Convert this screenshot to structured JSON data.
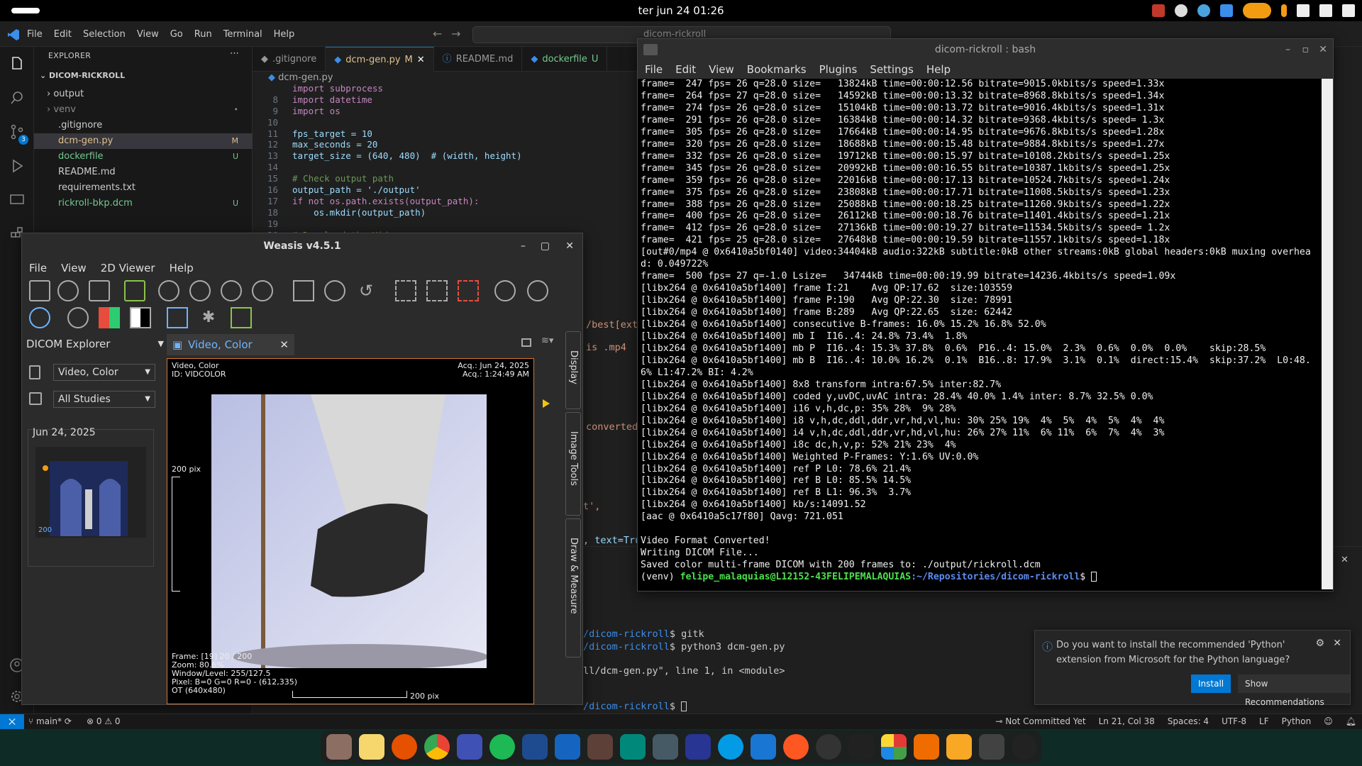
{
  "topbar": {
    "clock": "ter jun 24  01:26"
  },
  "vscode": {
    "menu": [
      "File",
      "Edit",
      "Selection",
      "View",
      "Go",
      "Run",
      "Terminal",
      "Help"
    ],
    "search": "dicom-rickroll",
    "explorer_title": "EXPLORER",
    "folder": "DICOM-RICKROLL",
    "tree": [
      {
        "label": "output",
        "type": "folder",
        "badge": ""
      },
      {
        "label": "venv",
        "type": "folder",
        "badge": "•"
      },
      {
        "label": ".gitignore",
        "type": "file",
        "badge": ""
      },
      {
        "label": "dcm-gen.py",
        "type": "file",
        "badge": "M"
      },
      {
        "label": "dockerfile",
        "type": "file",
        "badge": "U"
      },
      {
        "label": "README.md",
        "type": "file",
        "badge": ""
      },
      {
        "label": "requirements.txt",
        "type": "file",
        "badge": ""
      },
      {
        "label": "rickroll-bkp.dcm",
        "type": "file",
        "badge": "U"
      }
    ],
    "tabs": [
      {
        "label": ".gitignore",
        "badge": ""
      },
      {
        "label": "dcm-gen.py",
        "badge": "M"
      },
      {
        "label": "README.md",
        "badge": ""
      },
      {
        "label": "dockerfile",
        "badge": "U"
      }
    ],
    "breadcrumb": "dcm-gen.py",
    "code_lines": [
      {
        "n": "",
        "t": "import subprocess"
      },
      {
        "n": "8",
        "t": "import datetime"
      },
      {
        "n": "9",
        "t": "import os"
      },
      {
        "n": "10",
        "t": ""
      },
      {
        "n": "11",
        "t": "fps_target = 10"
      },
      {
        "n": "12",
        "t": "max_seconds = 20"
      },
      {
        "n": "13",
        "t": "target_size = (640, 480)  # (width, height)"
      },
      {
        "n": "14",
        "t": ""
      },
      {
        "n": "15",
        "t": "# Check output path"
      },
      {
        "n": "16",
        "t": "output_path = './output'"
      },
      {
        "n": "17",
        "t": "if not os.path.exists(output_path):"
      },
      {
        "n": "18",
        "t": "    os.mkdir(output_path)"
      },
      {
        "n": "19",
        "t": ""
      },
      {
        "n": "20",
        "t": "# Download the Video"
      }
    ],
    "behind_fragments": {
      "best": "/best[ext=",
      "mp4": "is .mp4",
      "converted": "converted.",
      "t": "t',",
      "text": ", text=Tru"
    },
    "behind_terminal": [
      {
        "p": "/dicom-rickroll",
        "t": "$ gitk"
      },
      {
        "p": "/dicom-rickroll",
        "t": "$ python3 dcm-gen.py"
      },
      {
        "p": "",
        "t": "ll/dcm-gen.py\", line 1, in <module>"
      },
      {
        "p": "",
        "t": ""
      },
      {
        "p": "/dicom-rickroll",
        "t": "$ "
      }
    ],
    "status": {
      "branch": "main*",
      "problems": "0",
      "warnings": "0",
      "right": [
        "Not Committed Yet",
        "Ln 21, Col 38",
        "Spaces: 4",
        "UTF-8",
        "LF",
        "Python"
      ]
    },
    "notification": {
      "text": "Do you want to install the recommended 'Python' extension from Microsoft for the Python language?",
      "install": "Install",
      "show": "Show Recommendations"
    }
  },
  "terminal": {
    "title": "dicom-rickroll : bash",
    "menu": [
      "File",
      "Edit",
      "View",
      "Bookmarks",
      "Plugins",
      "Settings",
      "Help"
    ],
    "lines": [
      "frame=  247 fps= 26 q=28.0 size=   13824kB time=00:00:12.56 bitrate=9015.0kbits/s speed=1.33x",
      "frame=  264 fps= 27 q=28.0 size=   14592kB time=00:00:13.32 bitrate=8968.8kbits/s speed=1.34x",
      "frame=  274 fps= 26 q=28.0 size=   15104kB time=00:00:13.72 bitrate=9016.4kbits/s speed=1.31x",
      "frame=  291 fps= 26 q=28.0 size=   16384kB time=00:00:14.32 bitrate=9368.4kbits/s speed= 1.3x",
      "frame=  305 fps= 26 q=28.0 size=   17664kB time=00:00:14.95 bitrate=9676.8kbits/s speed=1.28x",
      "frame=  320 fps= 26 q=28.0 size=   18688kB time=00:00:15.48 bitrate=9884.8kbits/s speed=1.27x",
      "frame=  332 fps= 26 q=28.0 size=   19712kB time=00:00:15.97 bitrate=10108.2kbits/s speed=1.25x",
      "frame=  345 fps= 26 q=28.0 size=   20992kB time=00:00:16.55 bitrate=10387.1kbits/s speed=1.25x",
      "frame=  359 fps= 26 q=28.0 size=   22016kB time=00:00:17.13 bitrate=10524.7kbits/s speed=1.24x",
      "frame=  375 fps= 26 q=28.0 size=   23808kB time=00:00:17.71 bitrate=11008.5kbits/s speed=1.23x",
      "frame=  388 fps= 26 q=28.0 size=   25088kB time=00:00:18.25 bitrate=11260.9kbits/s speed=1.22x",
      "frame=  400 fps= 26 q=28.0 size=   26112kB time=00:00:18.76 bitrate=11401.4kbits/s speed=1.21x",
      "frame=  412 fps= 26 q=28.0 size=   27136kB time=00:00:19.27 bitrate=11534.5kbits/s speed= 1.2x",
      "frame=  421 fps= 25 q=28.0 size=   27648kB time=00:00:19.59 bitrate=11557.1kbits/s speed=1.18x",
      "[out#0/mp4 @ 0x6410a5bf0140] video:34404kB audio:322kB subtitle:0kB other streams:0kB global headers:0kB muxing overhea",
      "d: 0.049722%",
      "frame=  500 fps= 27 q=-1.0 Lsize=   34744kB time=00:00:19.99 bitrate=14236.4kbits/s speed=1.09x",
      "[libx264 @ 0x6410a5bf1400] frame I:21    Avg QP:17.62  size:103559",
      "[libx264 @ 0x6410a5bf1400] frame P:190   Avg QP:22.30  size: 78991",
      "[libx264 @ 0x6410a5bf1400] frame B:289   Avg QP:22.65  size: 62442",
      "[libx264 @ 0x6410a5bf1400] consecutive B-frames: 16.0% 15.2% 16.8% 52.0%",
      "[libx264 @ 0x6410a5bf1400] mb I  I16..4: 24.8% 73.4%  1.8%",
      "[libx264 @ 0x6410a5bf1400] mb P  I16..4: 15.3% 37.8%  0.6%  P16..4: 15.0%  2.3%  0.6%  0.0%  0.0%    skip:28.5%",
      "[libx264 @ 0x6410a5bf1400] mb B  I16..4: 10.0% 16.2%  0.1%  B16..8: 17.9%  3.1%  0.1%  direct:15.4%  skip:37.2%  L0:48.",
      "6% L1:47.2% BI: 4.2%",
      "[libx264 @ 0x6410a5bf1400] 8x8 transform intra:67.5% inter:82.7%",
      "[libx264 @ 0x6410a5bf1400] coded y,uvDC,uvAC intra: 28.4% 40.0% 1.4% inter: 8.7% 32.5% 0.0%",
      "[libx264 @ 0x6410a5bf1400] i16 v,h,dc,p: 35% 28%  9% 28%",
      "[libx264 @ 0x6410a5bf1400] i8 v,h,dc,ddl,ddr,vr,hd,vl,hu: 30% 25% 19%  4%  5%  4%  5%  4%  4%",
      "[libx264 @ 0x6410a5bf1400] i4 v,h,dc,ddl,ddr,vr,hd,vl,hu: 26% 27% 11%  6% 11%  6%  7%  4%  3%",
      "[libx264 @ 0x6410a5bf1400] i8c dc,h,v,p: 52% 21% 23%  4%",
      "[libx264 @ 0x6410a5bf1400] Weighted P-Frames: Y:1.6% UV:0.0%",
      "[libx264 @ 0x6410a5bf1400] ref P L0: 78.6% 21.4%",
      "[libx264 @ 0x6410a5bf1400] ref B L0: 85.5% 14.5%",
      "[libx264 @ 0x6410a5bf1400] ref B L1: 96.3%  3.7%",
      "[libx264 @ 0x6410a5bf1400] kb/s:14091.52",
      "[aac @ 0x6410a5c17f80] Qavg: 721.051",
      "",
      "Video Format Converted!",
      "Writing DICOM File...",
      "Saved color multi-frame DICOM with 200 frames to: ./output/rickroll.dcm"
    ],
    "prompt_venv": "(venv) ",
    "prompt_user": "felipe_malaquias@L12152-43FELIPEMALAQUIAS",
    "prompt_path": ":~/Repositories/dicom-rickroll",
    "prompt_end": "$ "
  },
  "weasis": {
    "title": "Weasis v4.5.1",
    "menu": [
      "File",
      "View",
      "2D Viewer",
      "Help"
    ],
    "explorer": "DICOM Explorer",
    "series_select": "Video, Color",
    "studies_select": "All Studies",
    "study_date": "Jun 24, 2025",
    "thumb_num": "200",
    "viewer_tab": "Video, Color",
    "overlay_tl1": "Video, Color",
    "overlay_tl2": "ID: VIDCOLOR",
    "overlay_tr1": "Acq.: Jun 24, 2025",
    "overlay_tr2": "Acq.: 1:24:49 AM",
    "scale_v": "200 pix",
    "scale_h": "200 pix",
    "info": [
      "Frame: [19] 20 / 200",
      "Zoom: 80.6%",
      "Window/Level: 255/127.5",
      "Pixel:  B=0 G=0 R=0 - (612,335)",
      "OT (640x480)"
    ],
    "side_tabs": [
      "Display",
      "Image Tools",
      "Draw & Measure"
    ]
  },
  "colors": {
    "accent": "#0078d4",
    "orange": "#d4762f",
    "prompt_green": "#4be04b",
    "prompt_blue": "#5b8cf0"
  }
}
